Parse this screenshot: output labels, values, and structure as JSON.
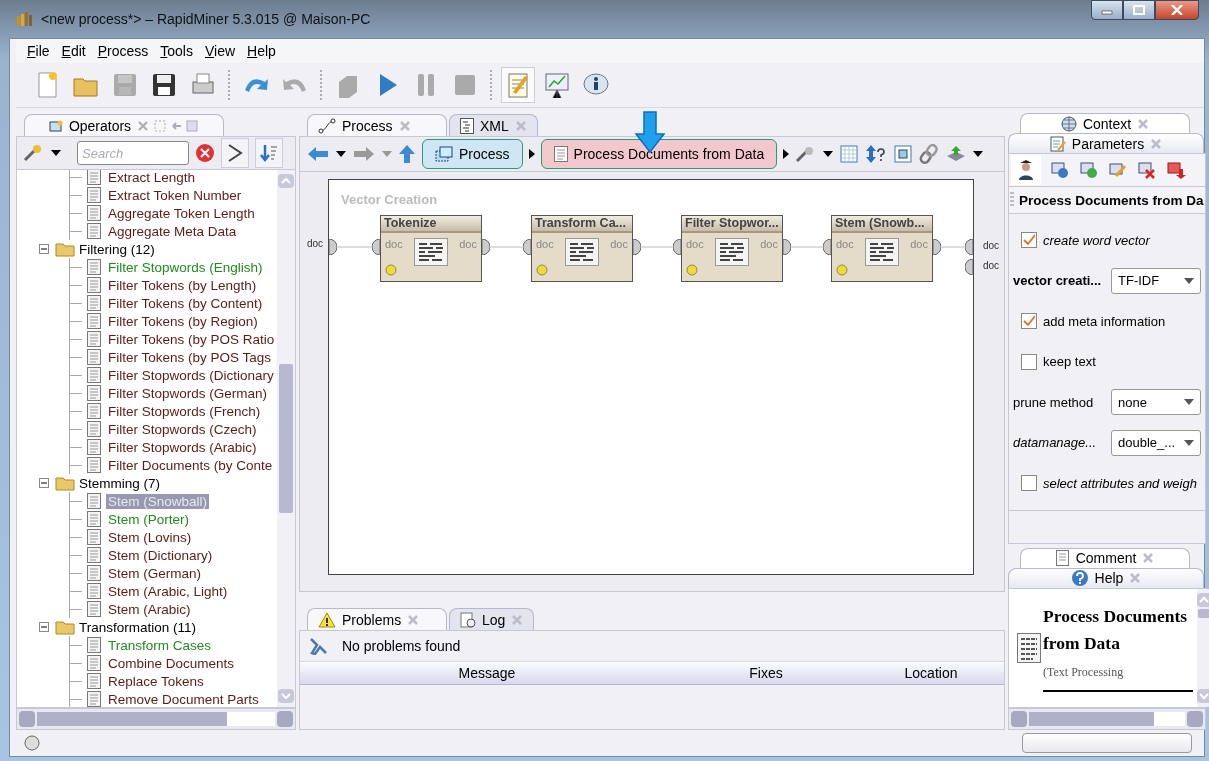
{
  "window": {
    "title": "<new process*> – RapidMiner 5.3.015 @ Maison-PC"
  },
  "menu": [
    {
      "label": "File"
    },
    {
      "label": "Edit"
    },
    {
      "label": "Process"
    },
    {
      "label": "Tools"
    },
    {
      "label": "View"
    },
    {
      "label": "Help"
    }
  ],
  "toolbar": [
    {
      "disabled": false,
      "selected": false
    },
    {
      "disabled": false,
      "selected": false
    },
    {
      "disabled": true,
      "selected": false
    },
    {
      "disabled": false,
      "selected": false
    },
    {
      "disabled": false,
      "selected": false
    },
    {
      "disabled": false,
      "selected": false
    },
    {
      "disabled": true,
      "selected": false
    },
    {
      "disabled": true,
      "selected": false
    },
    {
      "disabled": false,
      "selected": false
    },
    {
      "disabled": true,
      "selected": false
    },
    {
      "disabled": true,
      "selected": false
    },
    {
      "disabled": false,
      "selected": true
    },
    {
      "disabled": false,
      "selected": false
    },
    {
      "disabled": false,
      "selected": false
    }
  ],
  "operators_panel": {
    "tab": "Operators",
    "search": {
      "placeholder": "Search"
    },
    "tree": [
      {
        "children": [
          {
            "label": "Extract Length",
            "used": false,
            "selected": false
          },
          {
            "label": "Extract Token Number",
            "used": false,
            "selected": false
          },
          {
            "label": "Aggregate Token Length",
            "used": false,
            "selected": false
          },
          {
            "label": "Aggregate Meta Data",
            "used": false,
            "selected": false
          }
        ]
      },
      {
        "label": "Filtering (12)",
        "expanded": true,
        "children": [
          {
            "label": "Filter Stopwords (English)",
            "used": true,
            "selected": false
          },
          {
            "label": "Filter Tokens (by Length)",
            "used": false,
            "selected": false
          },
          {
            "label": "Filter Tokens (by Content)",
            "used": false,
            "selected": false
          },
          {
            "label": "Filter Tokens (by Region)",
            "used": false,
            "selected": false
          },
          {
            "label": "Filter Tokens (by POS Ratio",
            "used": false,
            "selected": false
          },
          {
            "label": "Filter Tokens (by POS Tags",
            "used": false,
            "selected": false
          },
          {
            "label": "Filter Stopwords (Dictionary",
            "used": false,
            "selected": false
          },
          {
            "label": "Filter Stopwords (German)",
            "used": false,
            "selected": false
          },
          {
            "label": "Filter Stopwords (French)",
            "used": false,
            "selected": false
          },
          {
            "label": "Filter Stopwords (Czech)",
            "used": false,
            "selected": false
          },
          {
            "label": "Filter Stopwords (Arabic)",
            "used": false,
            "selected": false
          },
          {
            "label": "Filter Documents (by Conte",
            "used": false,
            "selected": false
          }
        ]
      },
      {
        "label": "Stemming (7)",
        "expanded": true,
        "children": [
          {
            "label": "Stem (Snowball)",
            "used": true,
            "selected": true
          },
          {
            "label": "Stem (Porter)",
            "used": true,
            "selected": false
          },
          {
            "label": "Stem (Lovins)",
            "used": false,
            "selected": false
          },
          {
            "label": "Stem (Dictionary)",
            "used": false,
            "selected": false
          },
          {
            "label": "Stem (German)",
            "used": false,
            "selected": false
          },
          {
            "label": "Stem (Arabic, Light)",
            "used": false,
            "selected": false
          },
          {
            "label": "Stem (Arabic)",
            "used": false,
            "selected": false
          }
        ]
      },
      {
        "label": "Transformation (11)",
        "expanded": true,
        "children": [
          {
            "label": "Transform Cases",
            "used": true,
            "selected": false
          },
          {
            "label": "Combine Documents",
            "used": false,
            "selected": false
          },
          {
            "label": "Replace Tokens",
            "used": false,
            "selected": false
          },
          {
            "label": "Remove Document Parts",
            "used": false,
            "selected": false
          }
        ]
      }
    ]
  },
  "process_panel": {
    "tabs": [
      {
        "label": "Process",
        "selected": true
      },
      {
        "label": "XML",
        "selected": false
      }
    ],
    "breadcrumb": [
      {
        "label": "Process",
        "selected": false
      },
      {
        "label": "Process Documents from Data",
        "selected": true
      }
    ],
    "canvas": {
      "title": "Vector Creation",
      "inputs": [
        "doc"
      ],
      "outputs": [
        "doc",
        "doc"
      ],
      "operators": [
        {
          "name": "Tokenize",
          "input": "doc",
          "output": "doc"
        },
        {
          "name": "Transform Ca...",
          "input": "doc",
          "output": "doc"
        },
        {
          "name": "Filter Stopwor...",
          "input": "doc",
          "output": "doc"
        },
        {
          "name": "Stem (Snowb...",
          "input": "doc",
          "output": "doc"
        }
      ]
    }
  },
  "problems_panel": {
    "tabs": [
      {
        "label": "Problems",
        "selected": true
      },
      {
        "label": "Log",
        "selected": false
      }
    ],
    "message": "No problems found",
    "columns": [
      "Message",
      "Fixes",
      "Location"
    ]
  },
  "side_tabs": [
    {
      "label": "Context",
      "selected": false
    },
    {
      "label": "Parameters",
      "selected": true
    }
  ],
  "parameters": {
    "title": "Process Documents from Da",
    "rows": [
      {
        "kind": "checkbox",
        "label": "create word vector",
        "checked": true
      },
      {
        "kind": "dropdown",
        "label": "vector creati...",
        "value": "TF-IDF"
      },
      {
        "kind": "checkbox",
        "label": "add meta information",
        "checked": true
      },
      {
        "kind": "checkbox",
        "label": "keep text",
        "checked": false
      },
      {
        "kind": "dropdown",
        "label": "prune method",
        "value": "none"
      },
      {
        "kind": "dropdown",
        "label": "datamanage...",
        "value": "double_..."
      },
      {
        "kind": "checkbox",
        "label": "select attributes and weigh",
        "checked": false
      }
    ]
  },
  "help_tabs": [
    {
      "label": "Comment",
      "selected": false
    },
    {
      "label": "Help",
      "selected": true
    }
  ],
  "help": {
    "title": "Process Documents from Data",
    "category": "(Text Processing"
  }
}
